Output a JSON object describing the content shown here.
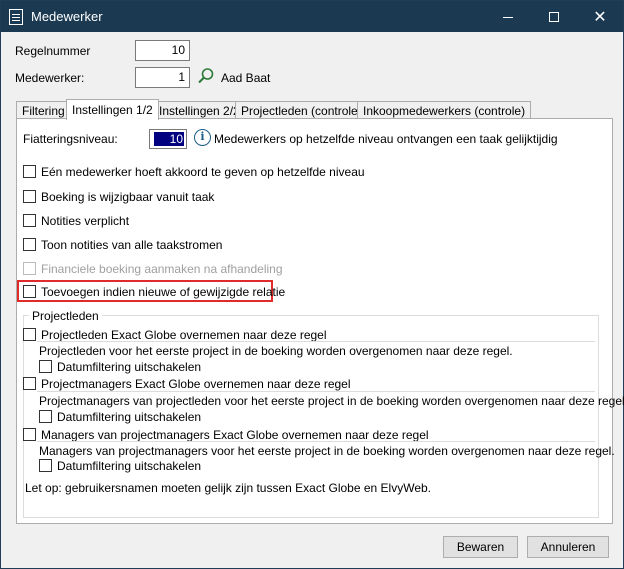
{
  "window": {
    "title": "Medewerker",
    "minimize_label": "–",
    "maximize_label": "□",
    "close_label": "✕"
  },
  "header": {
    "regelnummer_label": "Regelnummer",
    "regelnummer_value": "10",
    "medewerker_label": "Medewerker:",
    "medewerker_value": "1",
    "medewerker_name": "Aad Baat"
  },
  "tabs": [
    {
      "label": "Filtering"
    },
    {
      "label": "Instellingen 1/2"
    },
    {
      "label": "Instellingen 2/2"
    },
    {
      "label": "Projectleden (controle)"
    },
    {
      "label": "Inkoopmedewerkers (controle)"
    }
  ],
  "panel": {
    "fiatteringsniveau_label": "Fiatteringsniveau:",
    "fiatteringsniveau_value": "10",
    "info_text": "Medewerkers op hetzelfde niveau ontvangen een taak gelijktijdig",
    "checkboxes": [
      {
        "label": "Eén medewerker hoeft akkoord te geven op hetzelfde niveau"
      },
      {
        "label": "Boeking is wijzigbaar vanuit taak"
      },
      {
        "label": "Notities verplicht"
      },
      {
        "label": "Toon notities van alle taakstromen"
      },
      {
        "label": "Financiele boeking aanmaken na afhandeling"
      },
      {
        "label": "Toevoegen indien nieuwe of gewijzigde relatie"
      }
    ],
    "group": {
      "title": "Projectleden",
      "sections": [
        {
          "checkbox": "Projectleden Exact Globe overnemen naar deze regel",
          "description": "Projectleden voor het eerste project in de boeking worden overgenomen naar deze regel.",
          "sub_checkbox": "Datumfiltering uitschakelen"
        },
        {
          "checkbox": "Projectmanagers Exact Globe overnemen naar deze regel",
          "description": "Projectmanagers van projectleden voor het eerste project in de boeking worden overgenomen naar deze regel.",
          "sub_checkbox": "Datumfiltering uitschakelen"
        },
        {
          "checkbox": "Managers van projectmanagers Exact Globe overnemen naar deze regel",
          "description": "Managers van projectmanagers voor het eerste project in de boeking worden overgenomen naar deze regel.",
          "sub_checkbox": "Datumfiltering uitschakelen"
        }
      ],
      "note": "Let op: gebruikersnamen moeten gelijk zijn tussen Exact Globe en ElvyWeb."
    }
  },
  "footer": {
    "save_label": "Bewaren",
    "cancel_label": "Annuleren"
  },
  "colors": {
    "titlebar": "#1b3a52",
    "highlight": "#e02b2b",
    "selection": "#000080"
  }
}
